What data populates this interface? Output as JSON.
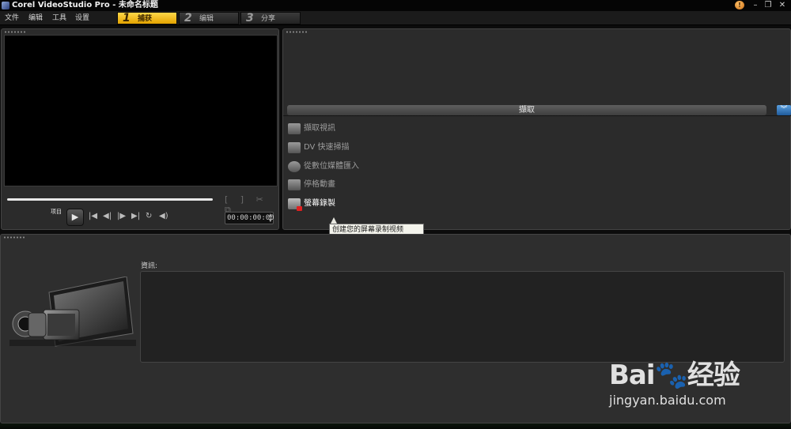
{
  "window": {
    "title": "Corel VideoStudio Pro - 未命名标题",
    "help_glyph": "!",
    "minimize": "–",
    "restore": "❐",
    "close": "✕"
  },
  "menu": [
    "文件",
    "编辑",
    "工具",
    "设置"
  ],
  "steps": [
    {
      "num": "1",
      "label": "捕获",
      "active": true
    },
    {
      "num": "2",
      "label": "编辑",
      "active": false
    },
    {
      "num": "3",
      "label": "分享",
      "active": false
    }
  ],
  "preview": {
    "project_label": "项目",
    "trim_icons": "[ ] ✂ ⧉",
    "transport": {
      "play": "▶",
      "home": "|◀",
      "prev": "◀|",
      "next": "|▶",
      "end": "▶|",
      "repeat": "↻",
      "volume": "◀)"
    },
    "timecode": "00:00:00:00",
    "spin_up": "▲",
    "spin_down": "▼"
  },
  "capture": {
    "header": "擷取",
    "collapse_glyph": "︾",
    "items": [
      {
        "label": "擷取視訊"
      },
      {
        "label": "DV 快速掃描"
      },
      {
        "label": "從數位媒體匯入"
      },
      {
        "label": "停格動畫"
      },
      {
        "label": "螢幕錄製"
      }
    ],
    "tooltip": "创建您的屏幕录制视频"
  },
  "info": {
    "label": "資訊:"
  },
  "watermark": {
    "logo": "Bai🐾经验",
    "url": "jingyan.baidu.com"
  },
  "colors": {
    "active_tab": "#ffd84a",
    "accent_blue": "#2f78c4",
    "record_red": "#e02020"
  }
}
